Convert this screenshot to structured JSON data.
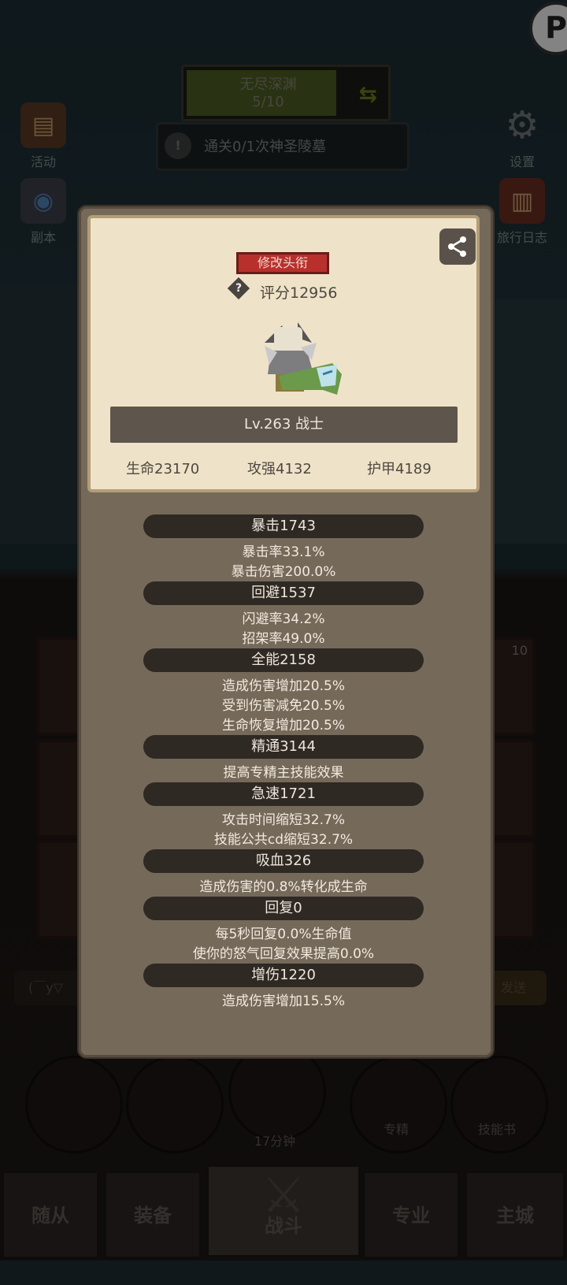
{
  "top": {
    "abyss_title": "无尽深渊",
    "abyss_progress": "5/10",
    "quest_text": "通关0/1次神圣陵墓",
    "side_left": [
      "活动",
      "副本"
    ],
    "side_right": [
      "设置",
      "旅行日志"
    ]
  },
  "background_ui": {
    "slot_badge": "10",
    "chat_placeholder": "(￣y▽",
    "send_label": "发送",
    "timer": "17分钟",
    "specialize_label": "专精",
    "skillbook_label": "技能书",
    "nav": [
      "随从",
      "装备",
      "战斗",
      "专业",
      "主城"
    ]
  },
  "profile": {
    "change_title_label": "修改头衔",
    "score_label": "评分12956",
    "level_class": "Lv.263 战士",
    "hp": "生命23170",
    "attack": "攻强4132",
    "armor": "护甲4189"
  },
  "sections": [
    {
      "header": "暴击1743",
      "lines": [
        "暴击率33.1%",
        "暴击伤害200.0%"
      ]
    },
    {
      "header": "回避1537",
      "lines": [
        "闪避率34.2%",
        "招架率49.0%"
      ]
    },
    {
      "header": "全能2158",
      "lines": [
        "造成伤害增加20.5%",
        "受到伤害减免20.5%",
        "生命恢复增加20.5%"
      ]
    },
    {
      "header": "精通3144",
      "lines": [
        "提高专精主技能效果"
      ]
    },
    {
      "header": "急速1721",
      "lines": [
        "攻击时间缩短32.7%",
        "技能公共cd缩短32.7%"
      ]
    },
    {
      "header": "吸血326",
      "lines": [
        "造成伤害的0.8%转化成生命"
      ]
    },
    {
      "header": "回复0",
      "lines": [
        "每5秒回复0.0%生命值",
        "使你的怒气回复效果提高0.0%"
      ]
    },
    {
      "header": "增伤1220",
      "lines": [
        "造成伤害增加15.5%"
      ]
    }
  ],
  "colors": {
    "panel": "#75695a",
    "card": "#eee3c8",
    "section_bar": "#2f2924",
    "title_button": "#b8302c",
    "text_light": "#f2eadf"
  }
}
